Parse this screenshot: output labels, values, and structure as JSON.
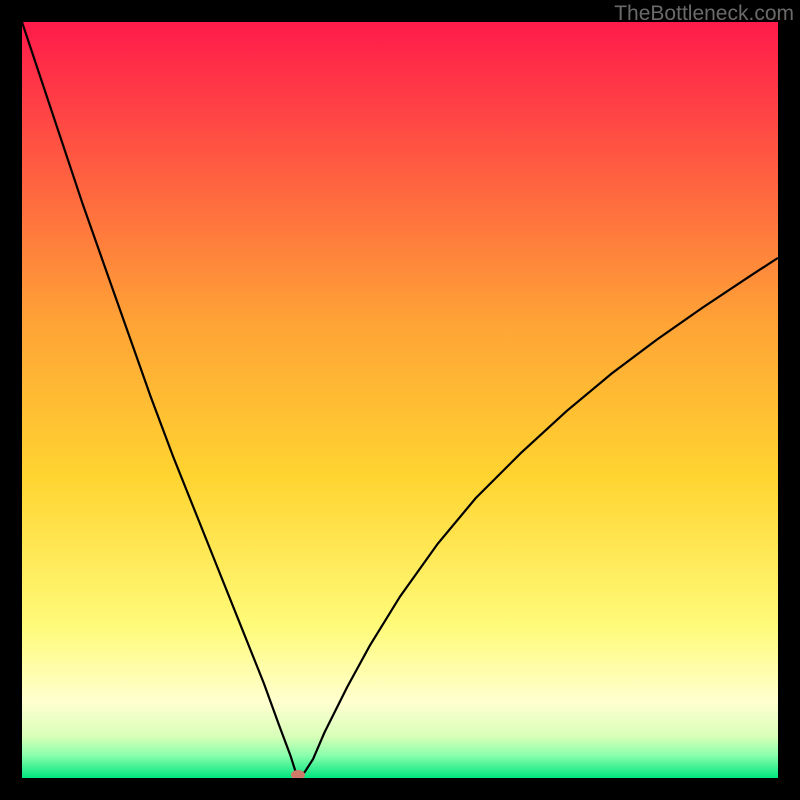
{
  "watermark": "TheBottleneck.com",
  "chart_data": {
    "type": "line",
    "title": "",
    "xlabel": "",
    "ylabel": "",
    "xlim": [
      0,
      100
    ],
    "ylim": [
      0,
      100
    ],
    "grid": false,
    "background_gradient": {
      "stops": [
        {
          "offset": 0.0,
          "color": "#ff1a4b"
        },
        {
          "offset": 0.4,
          "color": "#ffa436"
        },
        {
          "offset": 0.6,
          "color": "#ffd430"
        },
        {
          "offset": 0.8,
          "color": "#fffb7a"
        },
        {
          "offset": 0.9,
          "color": "#ffffd0"
        },
        {
          "offset": 0.945,
          "color": "#d8ffb8"
        },
        {
          "offset": 0.97,
          "color": "#8affad"
        },
        {
          "offset": 1.0,
          "color": "#00e57f"
        }
      ]
    },
    "series": [
      {
        "name": "bottleneck-curve",
        "color": "#000000",
        "stroke_width": 2.2,
        "x": [
          0,
          2,
          5,
          8,
          11,
          14,
          17,
          20,
          23,
          26,
          29,
          32,
          34,
          35.5,
          36.2,
          36.8,
          37.4,
          38.5,
          40,
          43,
          46,
          50,
          55,
          60,
          66,
          72,
          78,
          84,
          90,
          96,
          100
        ],
        "y": [
          100,
          94,
          85,
          76,
          67.5,
          59,
          50.5,
          42.5,
          35,
          27.5,
          20,
          12.5,
          7,
          3,
          0.8,
          0.3,
          0.8,
          2.5,
          6,
          12,
          17.5,
          24,
          31,
          37,
          43,
          48.5,
          53.5,
          58,
          62.2,
          66.2,
          68.8
        ]
      }
    ],
    "markers": [
      {
        "name": "optimal-point",
        "x": 36.5,
        "y": 0.4,
        "color": "#cf7a68",
        "rx": 7,
        "ry": 5
      }
    ]
  }
}
